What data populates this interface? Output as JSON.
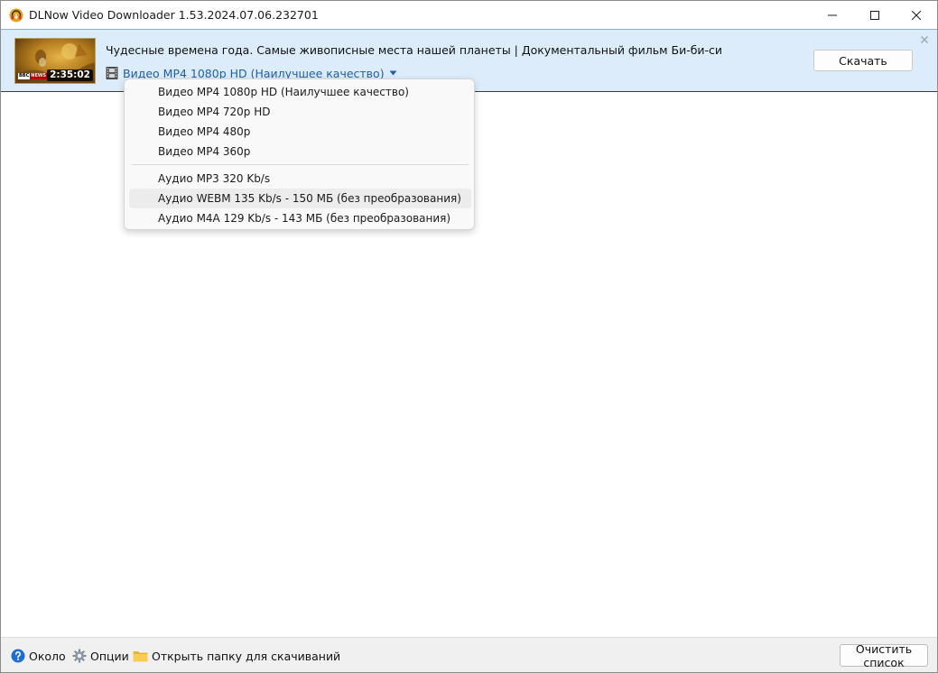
{
  "window": {
    "title": "DLNow Video Downloader 1.53.2024.07.06.232701"
  },
  "banner": {
    "video_title": "Чудесные времена года. Самые живописные места нашей планеты | Документальный фильм Би-би-си",
    "thumbnail_duration": "2:35:02",
    "thumbnail_badge_bbc": "BBC",
    "thumbnail_badge_news": "NEWS",
    "selected_format": "Видео MP4 1080p HD (Наилучшее качество)",
    "download_label": "Скачать"
  },
  "format_menu": {
    "video_options": [
      "Видео MP4 1080p HD (Наилучшее качество)",
      "Видео MP4 720p HD",
      "Видео MP4 480p",
      "Видео MP4 360p"
    ],
    "audio_options": [
      "Аудио MP3 320 Kb/s",
      "Аудио WEBM 135 Kb/s - 150 МБ (без преобразования)",
      "Аудио M4A 129 Kb/s - 143 МБ (без преобразования)"
    ],
    "hovered_option": "Аудио WEBM 135 Kb/s - 150 МБ (без преобразования)"
  },
  "statusbar": {
    "about_label": "Около",
    "options_label": "Опции",
    "open_folder_label": "Открыть папку для скачиваний",
    "clear_list_label": "Очистить список"
  },
  "icons": {
    "app": "headphones-download-icon",
    "format": "film-icon",
    "about": "help-icon",
    "options": "gear-icon",
    "folder": "folder-icon"
  },
  "colors": {
    "banner_bg": "#dcecfa",
    "format_link": "#1f5fa8",
    "menu_hover": "#ececec"
  }
}
